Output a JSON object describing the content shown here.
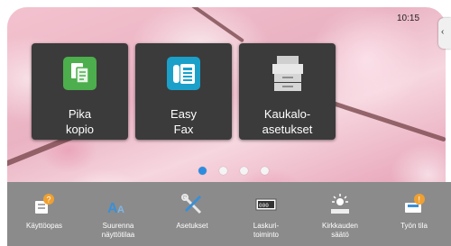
{
  "status": {
    "clock": "10:15",
    "edge_tab_glyph": "‹"
  },
  "tiles": [
    {
      "label_line1": "Pika",
      "label_line2": "kopio",
      "icon": "copy-icon",
      "color": "#4cae4c"
    },
    {
      "label_line1": "Easy",
      "label_line2": "Fax",
      "icon": "fax-icon",
      "color": "#1aa0c9"
    },
    {
      "label_line1": "Kaukalo-",
      "label_line2": "asetukset",
      "icon": "printer-icon"
    }
  ],
  "pager": {
    "pages": 4,
    "current": 1
  },
  "toolbar": {
    "items": [
      {
        "line1": "Käyttöopas",
        "line2": "",
        "icon": "manual-help-icon"
      },
      {
        "line1": "Suurenna",
        "line2": "näyttötilaa",
        "icon": "font-enlarge-icon"
      },
      {
        "line1": "Asetukset",
        "line2": "",
        "icon": "settings-tools-icon"
      },
      {
        "line1": "Laskuri-",
        "line2": "toiminto",
        "icon": "counter-icon"
      },
      {
        "line1": "Kirkkauden",
        "line2": "säätö",
        "icon": "brightness-icon"
      },
      {
        "line1": "Työn tila",
        "line2": "",
        "icon": "job-status-icon"
      }
    ]
  },
  "colors": {
    "accent": "#2c8de0",
    "toolbar_bg": "#8b8b8b",
    "tile_bg": "#3b3b3b"
  }
}
